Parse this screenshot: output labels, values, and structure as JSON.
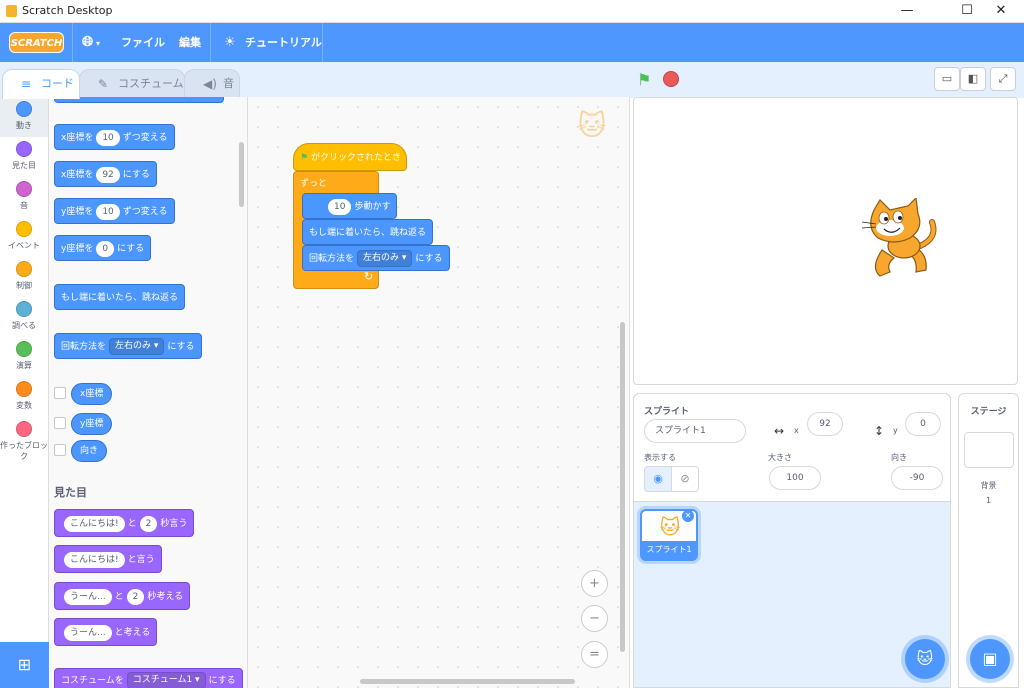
{
  "window": {
    "title": "Scratch Desktop",
    "min_icon": "minimize-icon",
    "max_icon": "maximize-icon",
    "close_icon": "close-icon"
  },
  "menubar": {
    "logo": "SCRATCH",
    "language_icon": "globe-icon",
    "file": "ファイル",
    "edit": "編集",
    "tutorials": "チュートリアル",
    "tutorials_icon": "lightbulb-icon"
  },
  "tabs": [
    {
      "label": "コード",
      "icon": "code-icon"
    },
    {
      "label": "コスチューム",
      "icon": "brush-icon"
    },
    {
      "label": "音",
      "icon": "speaker-icon"
    }
  ],
  "categories": [
    {
      "label": "動き",
      "color": "#4c97ff"
    },
    {
      "label": "見た目",
      "color": "#9966ff"
    },
    {
      "label": "音",
      "color": "#cf63cf"
    },
    {
      "label": "イベント",
      "color": "#ffbf00"
    },
    {
      "label": "制御",
      "color": "#ffab19"
    },
    {
      "label": "調べる",
      "color": "#5cb1d6"
    },
    {
      "label": "演算",
      "color": "#59c059"
    },
    {
      "label": "変数",
      "color": "#ff8c1a"
    },
    {
      "label": "作ったブロック",
      "color": "#ff6680"
    }
  ],
  "palette": {
    "change_x": {
      "pre": "x座標を",
      "val": "10",
      "post": "ずつ変える"
    },
    "set_x": {
      "pre": "x座標を",
      "val": "92",
      "post": "にする"
    },
    "change_y": {
      "pre": "y座標を",
      "val": "10",
      "post": "ずつ変える"
    },
    "set_y": {
      "pre": "y座標を",
      "val": "0",
      "post": "にする"
    },
    "bounce": "もし端に着いたら、跳ね返る",
    "rotation": {
      "pre": "回転方法を",
      "val": "左右のみ ▾",
      "post": "にする"
    },
    "xpos": "x座標",
    "ypos": "y座標",
    "direction": "向き",
    "looks_heading": "見た目",
    "say_secs": {
      "msg": "こんにちは!",
      "mid": "と",
      "val": "2",
      "post": "秒言う"
    },
    "say": {
      "msg": "こんにちは!",
      "post": "と言う"
    },
    "think_secs": {
      "msg": "うーん...",
      "mid": "と",
      "val": "2",
      "post": "秒考える"
    },
    "think": {
      "msg": "うーん...",
      "post": "と考える"
    },
    "costume": {
      "pre": "コスチュームを",
      "val": "コスチューム1 ▾",
      "post": "にする"
    }
  },
  "script": {
    "hat": "がクリックされたとき",
    "forever": "ずっと",
    "move": {
      "val": "10",
      "post": "歩動かす"
    },
    "bounce": "もし端に着いたら、跳ね返る",
    "rotation": {
      "pre": "回転方法を",
      "val": "左右のみ ▾",
      "post": "にする"
    },
    "loop_arrow": "↻"
  },
  "zoom": {
    "in": "+",
    "out": "−",
    "reset": "="
  },
  "sprite_info": {
    "sprite_label": "スプライト",
    "name": "スプライト1",
    "x_label": "x",
    "x": "92",
    "y_label": "y",
    "y": "0",
    "show_label": "表示する",
    "size_label": "大きさ",
    "size": "100",
    "direction_label": "向き",
    "direction": "-90"
  },
  "sprite_tile": {
    "name": "スプライト1"
  },
  "stage_pane": {
    "label": "ステージ",
    "backdrop_label": "背景",
    "backdrop_count": "1"
  }
}
